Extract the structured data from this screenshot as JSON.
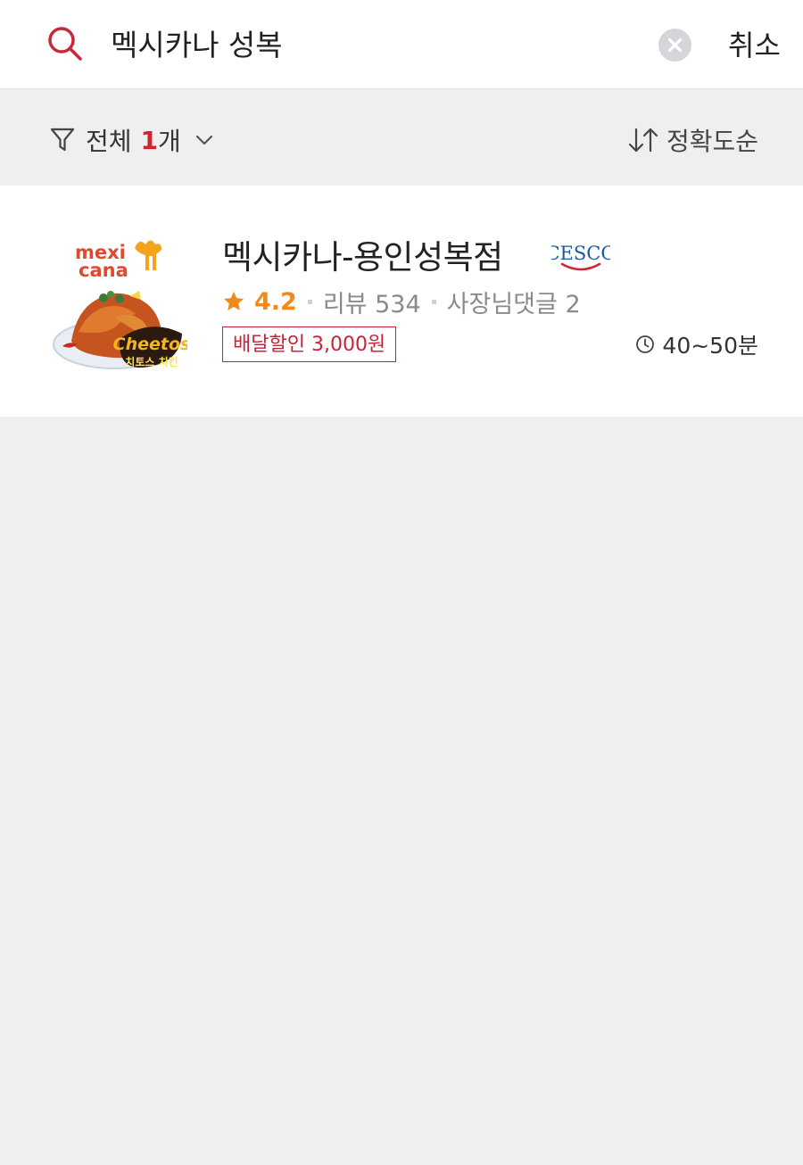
{
  "search": {
    "query": "멕시카나 성복",
    "cancel_label": "취소"
  },
  "filter": {
    "label": "전체",
    "count": "1",
    "unit": "개",
    "sort_label": "정확도순"
  },
  "results": [
    {
      "name": "멕시카나-용인성복점",
      "badge_brand": "CESCO",
      "rating": "4.2",
      "reviews": "리뷰 534",
      "owner_comments": "사장님댓글 2",
      "discount": "배달할인 3,000원",
      "delivery_time": "40~50분",
      "thumb": {
        "brand_line1": "mexi",
        "brand_line2": "cana",
        "promo_logo": "Cheetos",
        "promo_sub": "치토스 치킨"
      }
    }
  ],
  "colors": {
    "accent_red": "#d2242e",
    "rating_orange": "#f08a1d",
    "discount_red": "#c9223b",
    "background_gray": "#efeef1"
  },
  "icons": [
    "search-icon",
    "clear-icon",
    "filter-icon",
    "chevron-down-icon",
    "sort-icon",
    "star-icon",
    "clock-icon"
  ]
}
